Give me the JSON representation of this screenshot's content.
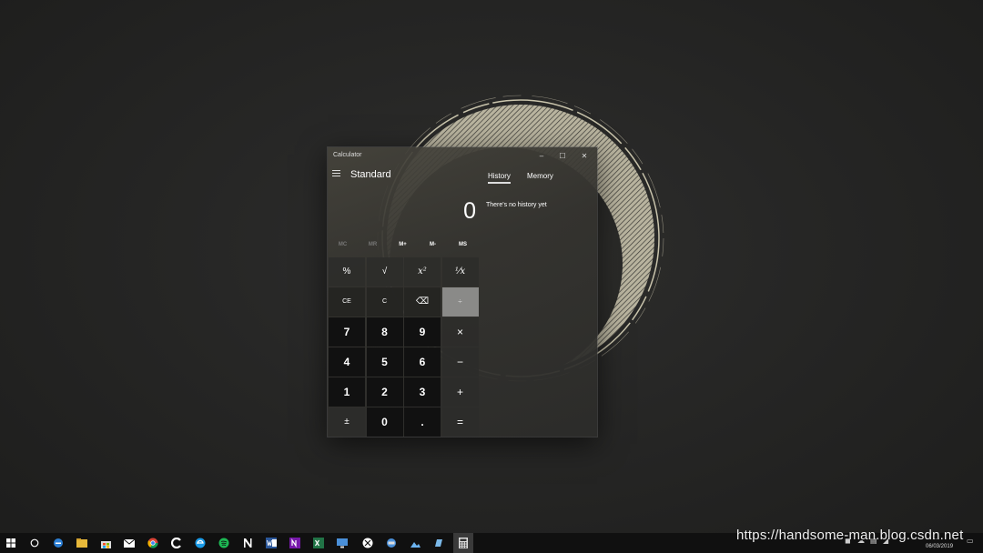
{
  "window": {
    "title": "Calculator",
    "minimize_icon": "–",
    "maximize_icon": "☐",
    "close_icon": "✕"
  },
  "calculator": {
    "mode_title": "Standard",
    "display_value": "0",
    "memory_buttons": [
      "MC",
      "MR",
      "M+",
      "M-",
      "MS"
    ],
    "keys": {
      "percent": "%",
      "sqrt": "√",
      "square": "x²",
      "reciprocal": "¹⁄x",
      "ce": "CE",
      "c": "C",
      "backspace": "⌫",
      "divide": "÷",
      "seven": "7",
      "eight": "8",
      "nine": "9",
      "multiply": "×",
      "four": "4",
      "five": "5",
      "six": "6",
      "minus": "−",
      "one": "1",
      "two": "2",
      "three": "3",
      "plus": "+",
      "negate": "±",
      "zero": "0",
      "decimal": ".",
      "equals": "="
    }
  },
  "side_panel": {
    "tabs": [
      "History",
      "Memory"
    ],
    "active_tab": "History",
    "empty_message": "There's no history yet"
  },
  "taskbar": {
    "clock_time": "...",
    "clock_date": "06/03/2019"
  },
  "watermark": "https://handsome-man.blog.csdn.net",
  "colors": {
    "desktop": "#262625",
    "taskbar": "#101010",
    "number_key": "#111111",
    "operator_key": "#2c2c2a",
    "accent_ring": "#c9c4ac"
  }
}
